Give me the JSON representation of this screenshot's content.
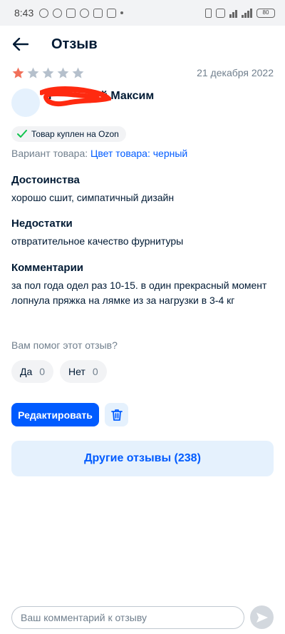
{
  "status_bar": {
    "time": "8:43",
    "battery": "80"
  },
  "header": {
    "title": "Отзыв",
    "back_icon": "arrow-left-icon"
  },
  "review": {
    "rating": 1,
    "max_rating": 5,
    "date": "21 декабря 2022",
    "author_visible": "Максим",
    "author_partial_left": "Г",
    "author_partial_mid": "й",
    "bought_badge": "Товар куплен на Ozon",
    "variant_label": "Вариант товара:",
    "variant_value": "Цвет товара: черный",
    "pros_title": "Достоинства",
    "pros_text": "хорошо сшит, симпатичный дизайн",
    "cons_title": "Недостатки",
    "cons_text": "отвратительное качество фурнитуры",
    "comment_title": "Комментарии",
    "comment_text": "за пол года одел раз 10-15. в один прекрасный момент лопнула пряжка на лямке из за нагрузки в 3-4 кг"
  },
  "helpful": {
    "question": "Вам помог этот отзыв?",
    "yes_label": "Да",
    "yes_count": "0",
    "no_label": "Нет",
    "no_count": "0"
  },
  "actions": {
    "edit_label": "Редактировать",
    "delete_icon": "trash-icon",
    "other_reviews_label": "Другие отзывы (238)"
  },
  "comment_box": {
    "placeholder": "Ваш комментарий к отзыву",
    "send_icon": "send-icon"
  },
  "colors": {
    "accent": "#005bff",
    "star_active": "#f1705a",
    "star_inactive": "#b5c0cc",
    "muted_text": "#707f8d",
    "chip_bg": "#f2f3f5",
    "light_blue_bg": "#e5f1fd",
    "success_check": "#10c44c"
  }
}
